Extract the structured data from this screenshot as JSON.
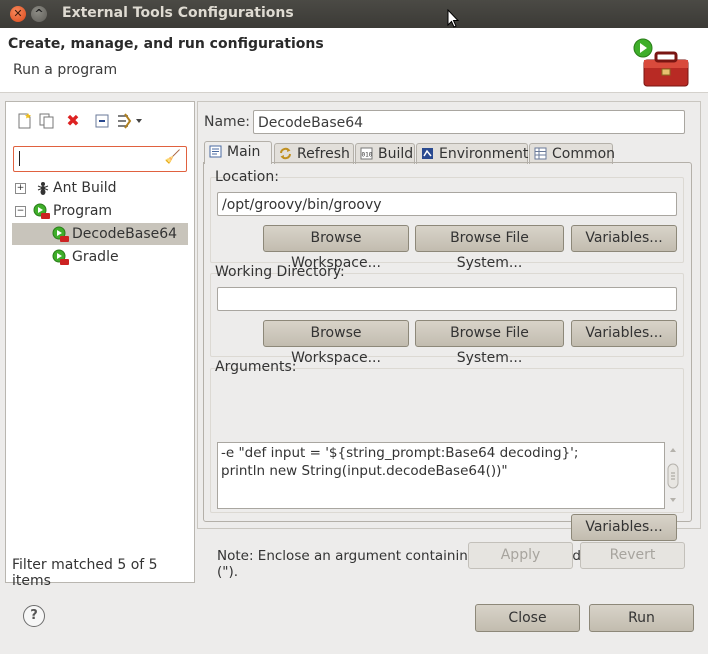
{
  "window": {
    "title": "External Tools Configurations"
  },
  "header": {
    "title": "Create, manage, and run configurations",
    "subtitle": "Run a program",
    "icon": "toolbox-run-icon"
  },
  "left_toolbar": {
    "icons": [
      "new-configuration-icon",
      "duplicate-icon",
      "delete-icon",
      "collapse-all-icon",
      "filter-dropdown-icon"
    ]
  },
  "filter": {
    "value": "",
    "placeholder": ""
  },
  "tree": {
    "items": [
      {
        "label": "Ant Build",
        "expander": "+",
        "icon": "ant-icon"
      },
      {
        "label": "Program",
        "expander": "−",
        "icon": "program-run-icon"
      },
      {
        "label": "DecodeBase64",
        "icon": "program-config-icon",
        "selected": true
      },
      {
        "label": "Gradle",
        "icon": "program-config-icon"
      }
    ]
  },
  "filter_status": "Filter matched 5 of 5 items",
  "name": {
    "label": "Name:",
    "value": "DecodeBase64"
  },
  "tabs": [
    {
      "label": "Main",
      "active": true,
      "icon": "main-tab-icon"
    },
    {
      "label": "Refresh",
      "icon": "refresh-icon"
    },
    {
      "label": "Build",
      "icon": "build-icon"
    },
    {
      "label": "Environment",
      "icon": "environment-icon"
    },
    {
      "label": "Common",
      "icon": "common-icon"
    }
  ],
  "location": {
    "label": "Location:",
    "value": "/opt/groovy/bin/groovy",
    "browse_workspace": "Browse Workspace...",
    "browse_filesystem": "Browse File System...",
    "variables": "Variables..."
  },
  "working_directory": {
    "label": "Working Directory:",
    "value": "",
    "browse_workspace": "Browse Workspace...",
    "browse_filesystem": "Browse File System...",
    "variables": "Variables..."
  },
  "arguments": {
    "label": "Arguments:",
    "line1": "-e \"def input = '${string_prompt:Base64 decoding}';",
    "line2": "println new String(input.decodeBase64())\"",
    "variables": "Variables...",
    "note": "Note: Enclose an argument containing spaces using double-quotes (\")."
  },
  "actions": {
    "apply": "Apply",
    "revert": "Revert",
    "close": "Close",
    "run": "Run"
  },
  "colors": {
    "selection": "#c8c4bb",
    "filter_border": "#e0613f",
    "title_bar": "#3b3a36"
  }
}
